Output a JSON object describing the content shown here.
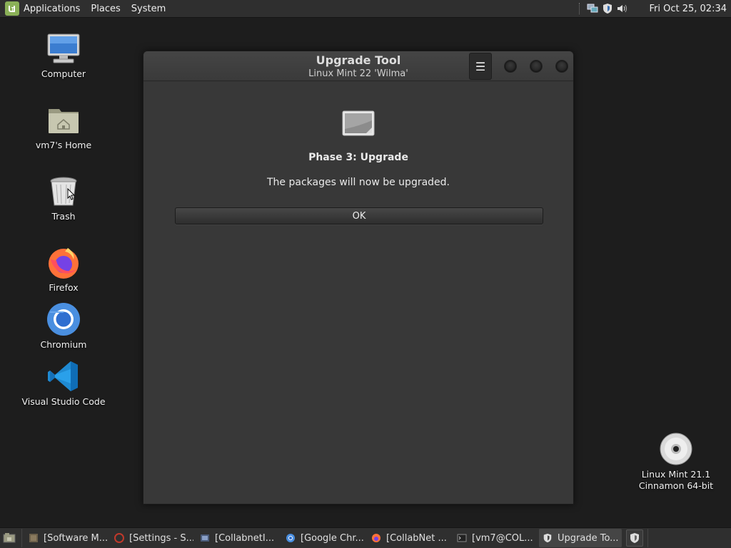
{
  "top_panel": {
    "menus": [
      "Applications",
      "Places",
      "System"
    ],
    "clock": "Fri Oct 25, 02:34",
    "tray_icons": [
      "network-icon",
      "shield-icon",
      "volume-icon"
    ]
  },
  "desktop": {
    "icons": [
      {
        "label": "Computer",
        "icon": "computer-icon"
      },
      {
        "label": "vm7's Home",
        "icon": "home-folder-icon"
      },
      {
        "label": "Trash",
        "icon": "trash-icon"
      },
      {
        "label": "Firefox",
        "icon": "firefox-icon"
      },
      {
        "label": "Chromium",
        "icon": "chromium-icon"
      },
      {
        "label": "Visual Studio Code",
        "icon": "vscode-icon"
      }
    ],
    "disc": {
      "line1": "Linux Mint 21.1",
      "line2": "Cinnamon 64-bit",
      "icon": "disc-icon"
    }
  },
  "dialog": {
    "title": "Upgrade Tool",
    "subtitle": "Linux Mint 22 'Wilma'",
    "menu_glyph": "☰",
    "phase_title": "Phase 3: Upgrade",
    "description": "The packages will now be upgraded.",
    "ok_label": "OK"
  },
  "taskbar": {
    "tasks": [
      {
        "label": "[Software M...",
        "icon": "software-manager-icon",
        "active": false
      },
      {
        "label": "[Settings - S...",
        "icon": "settings-icon",
        "active": false
      },
      {
        "label": "[CollabnetI...",
        "icon": "app-icon",
        "active": false
      },
      {
        "label": "[Google Chr...",
        "icon": "chrome-icon",
        "active": false
      },
      {
        "label": "[CollabNet ...",
        "icon": "firefox-icon",
        "active": false
      },
      {
        "label": "[vm7@COL...",
        "icon": "terminal-icon",
        "active": false
      },
      {
        "label": "Upgrade To...",
        "icon": "shield-icon",
        "active": true
      }
    ]
  },
  "colors": {
    "desktop_bg": "#1d1d1d",
    "panel_bg": "#2f2f2f",
    "dialog_bg": "#383838",
    "mint_green": "#8bb158"
  }
}
